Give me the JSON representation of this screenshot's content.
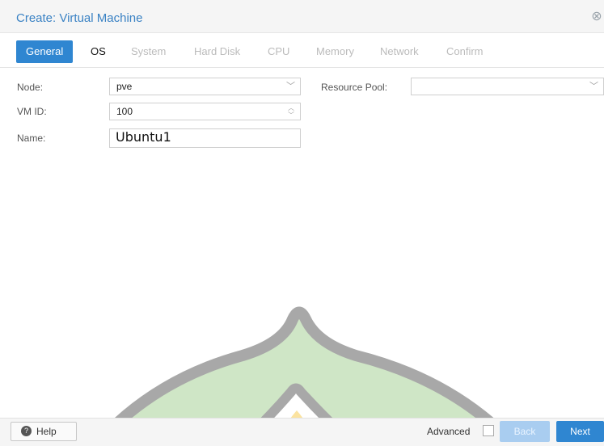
{
  "window": {
    "title": "Create: Virtual Machine"
  },
  "tabs": [
    {
      "label": "General",
      "state": "active"
    },
    {
      "label": "OS",
      "state": "enabled"
    },
    {
      "label": "System",
      "state": "disabled"
    },
    {
      "label": "Hard Disk",
      "state": "disabled"
    },
    {
      "label": "CPU",
      "state": "disabled"
    },
    {
      "label": "Memory",
      "state": "disabled"
    },
    {
      "label": "Network",
      "state": "disabled"
    },
    {
      "label": "Confirm",
      "state": "disabled"
    }
  ],
  "form": {
    "node": {
      "label": "Node:",
      "value": "pve"
    },
    "vmid": {
      "label": "VM ID:",
      "value": "100"
    },
    "name": {
      "label": "Name:",
      "value": "Ubuntu1"
    },
    "resource_pool": {
      "label": "Resource Pool:",
      "value": ""
    }
  },
  "footer": {
    "help_label": "Help",
    "advanced_label": "Advanced",
    "advanced_checked": false,
    "back_label": "Back",
    "next_label": "Next"
  },
  "colors": {
    "accent": "#2f86d1",
    "title": "#3a82c4",
    "watermark_gray": "#a8a8a8",
    "watermark_green": "#cfe6c6",
    "watermark_yellow": "#fbe3a0"
  },
  "icons": {
    "close": "close-circle-icon",
    "dropdown": "chevron-down-icon",
    "spinner": "spinner-arrows-icon",
    "help": "question-circle-icon"
  }
}
